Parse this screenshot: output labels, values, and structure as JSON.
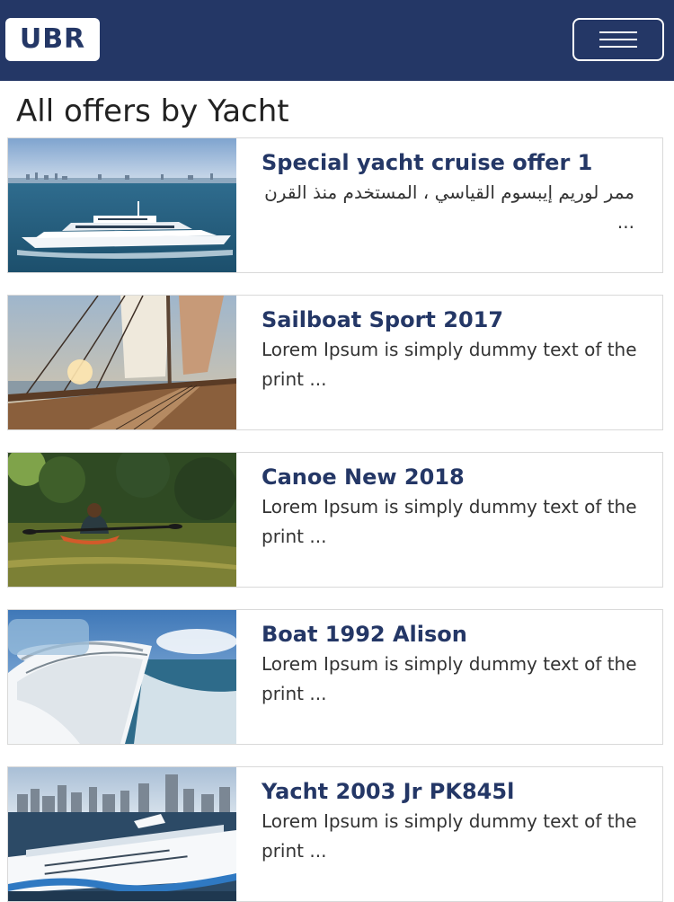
{
  "navbar": {
    "logo": "UBR",
    "menu_icon": "hamburger-icon",
    "background": "#243766"
  },
  "page": {
    "title": "All offers by Yacht"
  },
  "offers": [
    {
      "title": "Special yacht cruise offer 1",
      "desc": "ممر لوريم إيبسوم القياسي ، المستخدم منذ القرن ...",
      "image": "motor-yacht-at-sea"
    },
    {
      "title": "Sailboat Sport 2017",
      "desc": "Lorem Ipsum is simply dummy text of the print ...",
      "image": "sailboat-deck"
    },
    {
      "title": "Canoe New 2018",
      "desc": "Lorem Ipsum is simply dummy text of the print ...",
      "image": "kayak-on-river"
    },
    {
      "title": "Boat 1992 Alison",
      "desc": "Lorem Ipsum is simply dummy text of the print ...",
      "image": "boat-bow-wake"
    },
    {
      "title": "Yacht 2003 Jr PK845l",
      "desc": "Lorem Ipsum is simply dummy text of the print ...",
      "image": "cruise-ship-city"
    }
  ]
}
